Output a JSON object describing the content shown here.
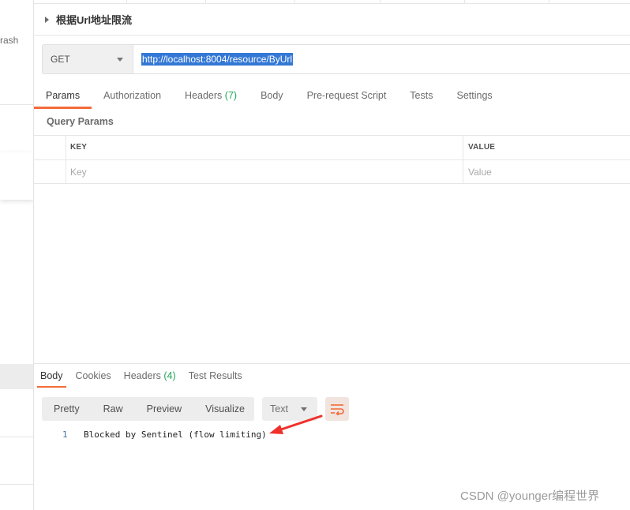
{
  "sidebar": {
    "fragment_text": "rash"
  },
  "request": {
    "title": "根据Url地址限流",
    "method": "GET",
    "url": "http://localhost:8004/resource/ByUrl",
    "tabs": [
      {
        "label": "Params",
        "count": ""
      },
      {
        "label": "Authorization",
        "count": ""
      },
      {
        "label": "Headers",
        "count": "(7)"
      },
      {
        "label": "Body",
        "count": ""
      },
      {
        "label": "Pre-request Script",
        "count": ""
      },
      {
        "label": "Tests",
        "count": ""
      },
      {
        "label": "Settings",
        "count": ""
      }
    ],
    "active_tab": "Params"
  },
  "query_params": {
    "section_label": "Query Params",
    "columns": {
      "key": "KEY",
      "value": "VALUE"
    },
    "placeholder": {
      "key": "Key",
      "value": "Value"
    }
  },
  "response": {
    "tabs": [
      {
        "label": "Body",
        "count": ""
      },
      {
        "label": "Cookies",
        "count": ""
      },
      {
        "label": "Headers",
        "count": "(4)"
      },
      {
        "label": "Test Results",
        "count": ""
      }
    ],
    "active_tab": "Body",
    "view_modes": [
      "Pretty",
      "Raw",
      "Preview",
      "Visualize"
    ],
    "format": "Text",
    "lines": [
      {
        "number": "1",
        "text": "Blocked by Sentinel (flow limiting)"
      }
    ]
  },
  "annotation": {
    "arrow_color": "#f0302a",
    "icon": "red-arrow-icon"
  },
  "colors": {
    "accent": "#f26b3a",
    "count_green": "#26a65b",
    "url_highlight": "#3478d6"
  },
  "watermark": "CSDN @younger编程世界"
}
